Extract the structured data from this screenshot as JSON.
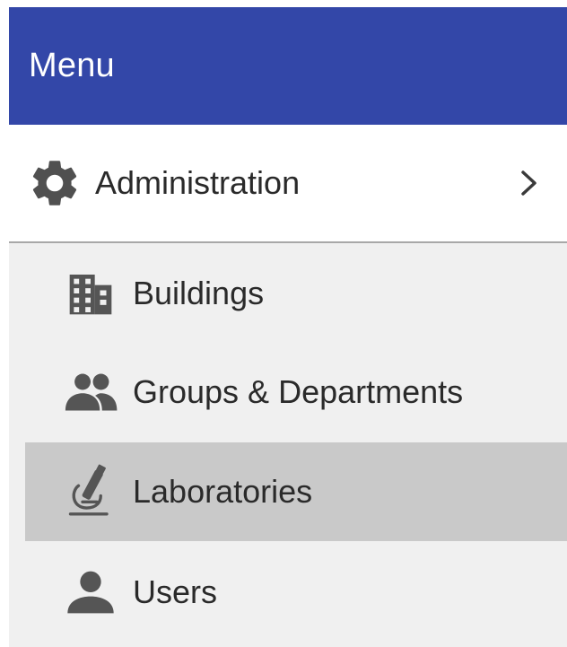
{
  "menu": {
    "title": "Menu"
  },
  "section": {
    "label": "Administration",
    "icon": "gear-icon",
    "expand_icon": "chevron-right-icon"
  },
  "items": [
    {
      "label": "Buildings",
      "icon": "building-icon",
      "selected": false
    },
    {
      "label": "Groups & Departments",
      "icon": "people-icon",
      "selected": false
    },
    {
      "label": "Laboratories",
      "icon": "microscope-icon",
      "selected": true
    },
    {
      "label": "Users",
      "icon": "person-icon",
      "selected": false
    }
  ],
  "colors": {
    "header_bg": "#3347a8",
    "selected_bg": "#c9c9c9",
    "list_bg": "#f0f0f0",
    "icon": "#555555"
  }
}
